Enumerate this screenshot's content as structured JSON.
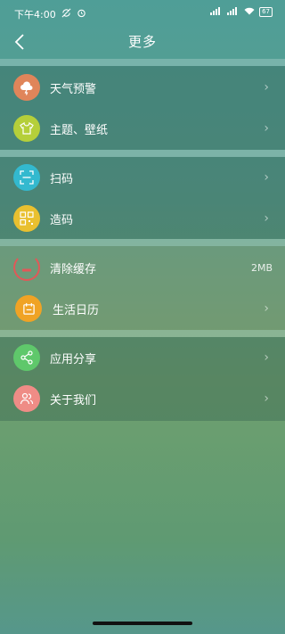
{
  "status_bar": {
    "time": "下午4:00",
    "battery": "67"
  },
  "header": {
    "title": "更多"
  },
  "groups": [
    {
      "items": [
        {
          "label": "天气预警",
          "icon": "cloud-alert-icon",
          "color": "#e0855a"
        },
        {
          "label": "主题、壁纸",
          "icon": "tshirt-icon",
          "color": "#b5cf3a"
        }
      ]
    },
    {
      "items": [
        {
          "label": "扫码",
          "icon": "scan-icon",
          "color": "#33b9cf"
        },
        {
          "label": "造码",
          "icon": "qrcode-icon",
          "color": "#e9c02f"
        }
      ]
    },
    {
      "items": [
        {
          "label": "清除缓存",
          "icon": "clear-cache-icon",
          "color": "#e15858",
          "value": "2MB"
        },
        {
          "label": "生活日历",
          "icon": "calendar-icon",
          "color": "#f0a325"
        }
      ]
    },
    {
      "items": [
        {
          "label": "应用分享",
          "icon": "share-icon",
          "color": "#5fc86b"
        },
        {
          "label": "关于我们",
          "icon": "about-us-icon",
          "color": "#ef8c86"
        }
      ]
    }
  ]
}
